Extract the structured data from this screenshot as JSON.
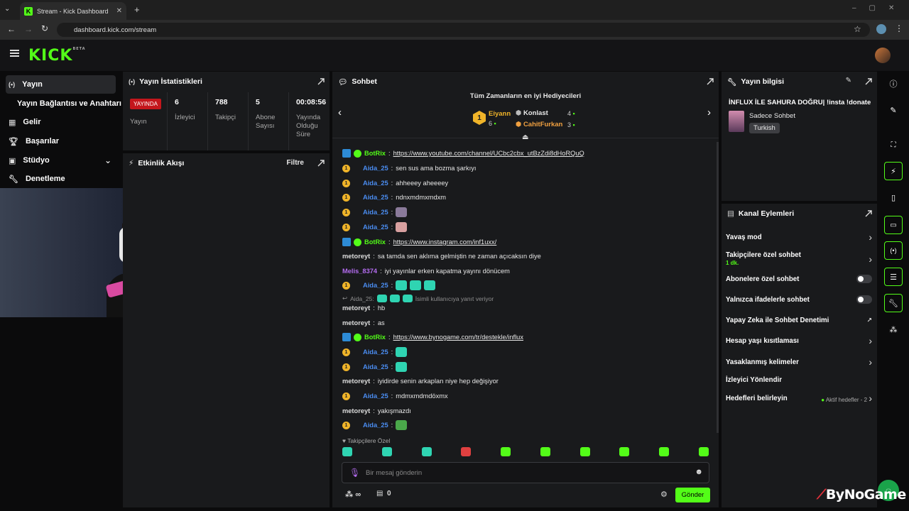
{
  "browser": {
    "tab_title": "Stream - Kick Dashboard",
    "url": "dashboard.kick.com/stream"
  },
  "app": {
    "logo": "KICK",
    "logo_tag": "BETA"
  },
  "nav": {
    "items": [
      {
        "label": "Yayın"
      },
      {
        "label": "Yayın Bağlantısı ve Anahtarı"
      },
      {
        "label": "Gelir"
      },
      {
        "label": "Başarılar"
      },
      {
        "label": "Stüdyo"
      },
      {
        "label": "Denetleme"
      }
    ]
  },
  "stats": {
    "title": "Yayın İstatistikleri",
    "live_badge": "YAYINDA",
    "live_label": "Yayın",
    "items": [
      {
        "value": "6",
        "label": "İzleyici"
      },
      {
        "value": "788",
        "label": "Takipçi"
      },
      {
        "value": "5",
        "label": "Abone Sayısı"
      },
      {
        "value": "00:08:56",
        "label": "Yayında Olduğu Süre"
      }
    ]
  },
  "activity": {
    "title": "Etkinlik Akışı",
    "filter": "Filtre"
  },
  "chat": {
    "title": "Sohbet",
    "gifters_title": "Tüm Zamanların en iyi Hediyecileri",
    "top1_name": "Eiyann",
    "top1_count": "6",
    "top2_name": "Konlast",
    "top2_count": "4",
    "top3_name": "CahitFurkan",
    "top3_count": "3",
    "messages": [
      {
        "user": "BotRix",
        "text": "https://www.youtube.com/channel/UCbc2cbx_utBzZdi8dHoRQuQ"
      },
      {
        "user": "Aida_25",
        "text": "sen sus ama bozma şarkıyı"
      },
      {
        "user": "Aida_25",
        "text": "ahheeey aheeeey"
      },
      {
        "user": "Aida_25",
        "text": "ndnxmdmxmdxm"
      },
      {
        "user": "Aida_25",
        "text": ""
      },
      {
        "user": "Aida_25",
        "text": ""
      },
      {
        "user": "BotRix",
        "text": "https://www.instagram.com/inf1uxx/"
      },
      {
        "user": "metoreyt",
        "text": "sa tamda sen aklıma gelmiştin ne zaman açıcaksın diye"
      },
      {
        "user": "Melis_8374",
        "text": "iyi yayınlar erken kapatma yayını dönücem"
      },
      {
        "user": "Aida_25",
        "text": ""
      },
      {
        "user": "metoreyt",
        "text": "hb"
      },
      {
        "user": "metoreyt",
        "text": "as"
      },
      {
        "user": "BotRix",
        "text": "https://www.bynogame.com/tr/destekle/influx"
      },
      {
        "user": "Aida_25",
        "text": ""
      },
      {
        "user": "Aida_25",
        "text": ""
      },
      {
        "user": "metoreyt",
        "text": "iyidirde senin arkaplan niye hep değişiyor"
      },
      {
        "user": "Aida_25",
        "text": "mdmxmdmdöxmx"
      },
      {
        "user": "metoreyt",
        "text": "yakışmazdı"
      },
      {
        "user": "Aida_25",
        "text": ""
      }
    ],
    "reply_user": "Aida_25:",
    "reply_note": "İsimli kullanıcıya yanıt veriyor",
    "followers_only": "Takipçilere Özel",
    "input_placeholder": "Bir mesaj gönderin",
    "points": "∞",
    "store_count": "0",
    "send": "Gönder"
  },
  "stream_info": {
    "title": "Yayın bilgisi",
    "stream_title": "İNFLUX İLE SAHURA DOĞRU| !insta !donate",
    "category": "Sadece Sohbet",
    "language": "Turkish"
  },
  "channel_actions": {
    "title": "Kanal Eylemleri",
    "slow_mode": "Yavaş mod",
    "followers_chat": "Takipçilere özel sohbet",
    "followers_chat_sub": "1 dk.",
    "subs_chat": "Abonelere özel sohbet",
    "emote_chat": "Yalnızca ifadelerle sohbet",
    "ai_mod": "Yapay Zeka ile Sohbet Denetimi",
    "age_restrict": "Hesap yaşı kısıtlaması",
    "banned_words": "Yasaklanmış kelimeler",
    "raid": "İzleyici Yönlendir",
    "goals": "Hedefleri belirleyin",
    "goals_status": "Aktif hedefler - 2"
  },
  "watermark": "ByNoGame",
  "colors": {
    "kick_green": "#53fc18",
    "live_red": "#c4161c",
    "user_blue": "#4a8cf0",
    "user_purple": "#b46cf0"
  }
}
